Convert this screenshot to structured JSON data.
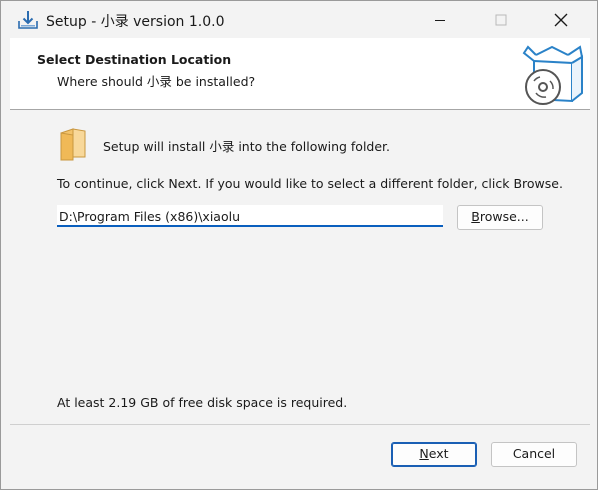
{
  "window": {
    "title": "Setup - 小录 version 1.0.0",
    "app_icon": "installer-download-icon"
  },
  "title_controls": {
    "minimize_icon": "minimize-icon",
    "maximize_icon": "maximize-icon",
    "close_icon": "close-icon"
  },
  "header": {
    "title": "Select Destination Location",
    "subtitle": "Where should 小录 be installed?",
    "graphic": "box-with-disc-icon"
  },
  "body": {
    "folder_icon": "folder-icon",
    "install_text": "Setup will install 小录 into the following folder.",
    "continue_text": "To continue, click Next. If you would like to select a different folder, click Browse.",
    "path_value": "D:\\Program Files (x86)\\xiaolu",
    "browse": {
      "underlined": "B",
      "rest": "rowse..."
    },
    "disk_space_text": "At least 2.19 GB of free disk space is required."
  },
  "footer": {
    "next": {
      "underlined": "N",
      "rest": "ext"
    },
    "cancel_label": "Cancel"
  },
  "colors": {
    "accent": "#0a5fbe",
    "folder": "#f3c36b",
    "box": "#2a82c8",
    "window_bg": "#f3f3f3",
    "header_bg": "#ffffff"
  }
}
